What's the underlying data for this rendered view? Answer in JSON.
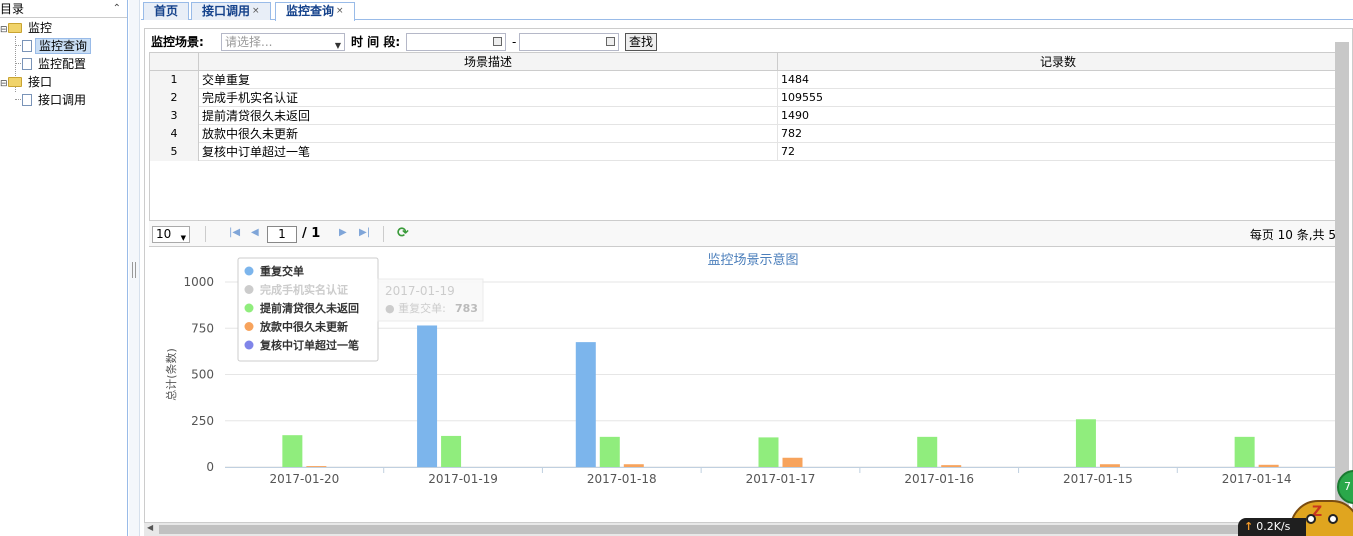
{
  "sidebar": {
    "title": "目录",
    "nodes": [
      {
        "label": "监控",
        "type": "folder"
      },
      {
        "label": "监控查询",
        "type": "doc",
        "selected": true
      },
      {
        "label": "监控配置",
        "type": "doc"
      },
      {
        "label": "接口",
        "type": "folder"
      },
      {
        "label": "接口调用",
        "type": "doc"
      }
    ]
  },
  "tabs": [
    {
      "label": "首页",
      "closable": false
    },
    {
      "label": "接口调用",
      "closable": true
    },
    {
      "label": "监控查询",
      "closable": true,
      "active": true
    }
  ],
  "close_glyph": "×",
  "search": {
    "scene_label": "监控场景:",
    "scene_placeholder": "请选择...",
    "period_label": "时 间 段:",
    "date_sep": "-",
    "start_date": "",
    "end_date": "",
    "find_label": "查找"
  },
  "table": {
    "columns": [
      "场景描述",
      "记录数"
    ],
    "rows": [
      {
        "no": "1",
        "desc": "交单重复",
        "count": "1484"
      },
      {
        "no": "2",
        "desc": "完成手机实名认证",
        "count": "109555"
      },
      {
        "no": "3",
        "desc": "提前清贷很久未返回",
        "count": "1490"
      },
      {
        "no": "4",
        "desc": "放款中很久未更新",
        "count": "782"
      },
      {
        "no": "5",
        "desc": "复核中订单超过一笔",
        "count": "72"
      }
    ]
  },
  "pager": {
    "page_size": "10",
    "current_page": "1",
    "total_pages": "/ 1",
    "info": "每页 10 条,共 5"
  },
  "chart_data": {
    "type": "bar",
    "title": "监控场景示意图",
    "ylabel": "总计(条数)",
    "xlabel": "",
    "ylim": [
      0,
      1000
    ],
    "yticks": [
      "0",
      "250",
      "500",
      "750",
      "1000"
    ],
    "categories": [
      "2017-01-20",
      "2017-01-19",
      "2017-01-18",
      "2017-01-17",
      "2017-01-16",
      "2017-01-15",
      "2017-01-14"
    ],
    "series": [
      {
        "name": "重复交单",
        "color": "#7cb5ec",
        "values": [
          0,
          765,
          675,
          0,
          0,
          0,
          0
        ],
        "visible": true
      },
      {
        "name": "完成手机实名认证",
        "color": "#cccccc",
        "values": [
          0,
          0,
          0,
          0,
          0,
          0,
          0
        ],
        "visible": false
      },
      {
        "name": "提前清贷很久未返回",
        "color": "#90ed7d",
        "values": [
          172,
          168,
          163,
          160,
          163,
          258,
          163
        ],
        "visible": true
      },
      {
        "name": "放款中很久未更新",
        "color": "#f7a35c",
        "values": [
          5,
          0,
          15,
          50,
          10,
          15,
          12
        ],
        "visible": true
      },
      {
        "name": "复核中订单超过一笔",
        "color": "#8085e9",
        "values": [
          0,
          0,
          0,
          0,
          0,
          0,
          0
        ],
        "visible": true
      }
    ],
    "tooltip": {
      "header": "2017-01-19",
      "series": "重复交单",
      "value": "783"
    }
  },
  "widgets": {
    "speed": "0.2K/s",
    "ball_text": "7"
  }
}
